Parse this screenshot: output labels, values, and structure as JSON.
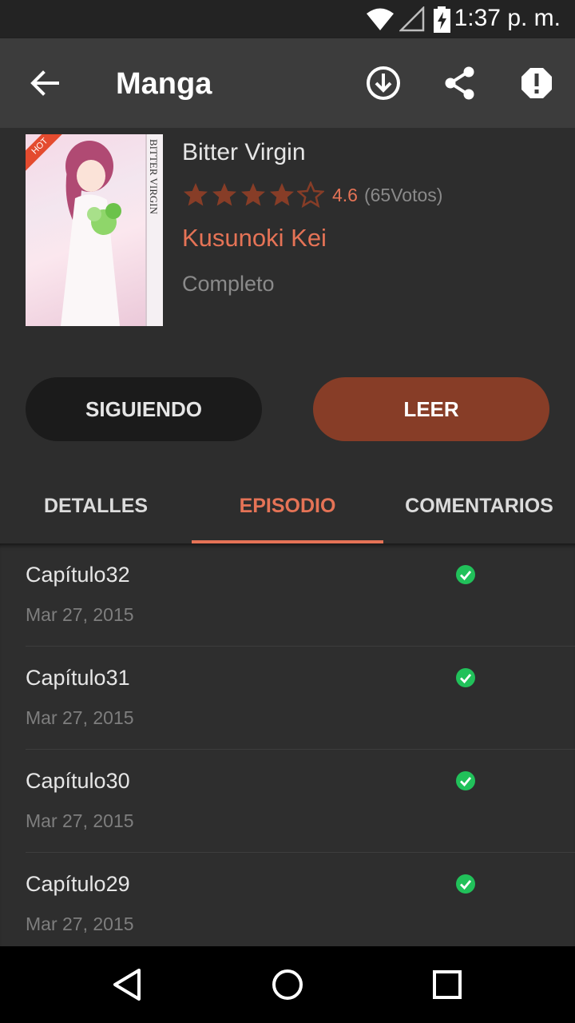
{
  "status_bar": {
    "time": "1:37 p. m.",
    "icons": [
      "wifi-icon",
      "signal-icon",
      "battery-charging-icon"
    ]
  },
  "app_bar": {
    "title": "Manga",
    "icons": [
      "back-arrow-icon",
      "download-icon",
      "share-icon",
      "report-icon"
    ]
  },
  "manga": {
    "title": "Bitter Virgin",
    "rating": "4.6",
    "rating_stars": 4.5,
    "votes": "(65Votos)",
    "author": "Kusunoki Kei",
    "status": "Completo",
    "cover_badge": "HOT",
    "cover_spine_text": "BITTER VIRGIN"
  },
  "actions": {
    "follow_label": "SIGUIENDO",
    "read_label": "LEER"
  },
  "tabs": [
    {
      "label": "DETALLES",
      "active": false
    },
    {
      "label": "EPISODIO",
      "active": true
    },
    {
      "label": "COMENTARIOS",
      "active": false
    }
  ],
  "chapters": [
    {
      "title": "Capítulo32",
      "date": "Mar 27, 2015",
      "read": true
    },
    {
      "title": "Capítulo31",
      "date": "Mar 27, 2015",
      "read": true
    },
    {
      "title": "Capítulo30",
      "date": "Mar 27, 2015",
      "read": true
    },
    {
      "title": "Capítulo29",
      "date": "Mar 27, 2015",
      "read": true
    }
  ],
  "nav_bar": {
    "icons": [
      "back-triangle-icon",
      "home-circle-icon",
      "recents-square-icon"
    ]
  },
  "colors": {
    "accent": "#e57356",
    "read_button": "#873d27",
    "check": "#21c15a"
  }
}
